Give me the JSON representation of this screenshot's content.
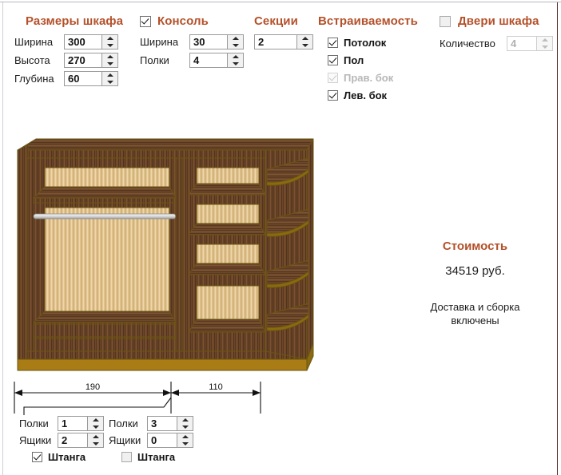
{
  "groups": {
    "dimensions": {
      "title": "Размеры шкафа",
      "fields": [
        {
          "label": "Ширина",
          "value": "300"
        },
        {
          "label": "Высота",
          "value": "270"
        },
        {
          "label": "Глубина",
          "value": "60"
        }
      ]
    },
    "console": {
      "title": "Консоль",
      "enabled": true,
      "fields": [
        {
          "label": "Ширина",
          "value": "30"
        },
        {
          "label": "Полки",
          "value": "4"
        }
      ]
    },
    "sections": {
      "title": "Секции",
      "value": "2"
    },
    "embedding": {
      "title": "Встраиваемость",
      "items": [
        {
          "label": "Потолок",
          "checked": true,
          "disabled": false
        },
        {
          "label": "Пол",
          "checked": true,
          "disabled": false
        },
        {
          "label": "Прав. бок",
          "checked": true,
          "disabled": true
        },
        {
          "label": "Лев. бок",
          "checked": true,
          "disabled": false
        }
      ]
    },
    "doors": {
      "title": "Двери шкафа",
      "enabled": false,
      "count_label": "Количество",
      "count_value": "4"
    }
  },
  "dimension_line": {
    "segments": [
      {
        "label": "190"
      },
      {
        "label": "110"
      }
    ]
  },
  "section_controls": [
    {
      "shelves_label": "Полки",
      "shelves_value": "1",
      "drawers_label": "Ящики",
      "drawers_value": "2",
      "rail_label": "Штанга",
      "rail_checked": true
    },
    {
      "shelves_label": "Полки",
      "shelves_value": "3",
      "drawers_label": "Ящики",
      "drawers_value": "0",
      "rail_label": "Штанга",
      "rail_checked": false
    }
  ],
  "price": {
    "title": "Стоимость",
    "amount": "34519 руб.",
    "note_line1": "Доставка и сборка",
    "note_line2": "включены"
  },
  "colors": {
    "heading": "#b4512a",
    "wood_dark": "#6b4326",
    "wood_light": "#e2c592",
    "edge_gold": "#8a6a10",
    "rail_metal": "#d8d8d8"
  }
}
